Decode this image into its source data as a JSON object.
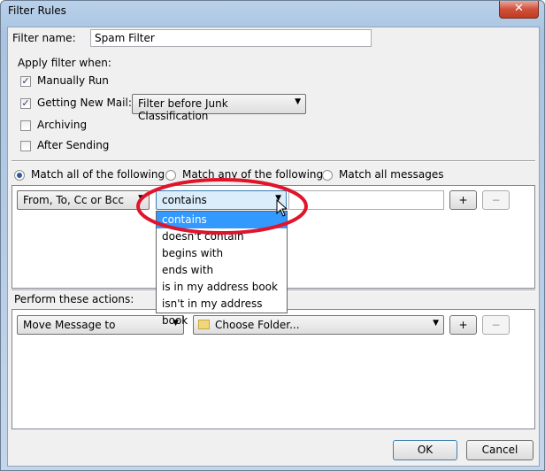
{
  "window": {
    "title": "Filter Rules",
    "close_glyph": "✕"
  },
  "filter_name": {
    "label": "Filter name:",
    "value": "Spam Filter"
  },
  "apply_when": {
    "legend": "Apply filter when:",
    "options": [
      {
        "label": "Manually Run",
        "checked": true,
        "mark": "✓"
      },
      {
        "label": "Getting New Mail:",
        "checked": true,
        "mark": "✓"
      },
      {
        "label": "Archiving",
        "checked": false,
        "mark": ""
      },
      {
        "label": "After Sending",
        "checked": false,
        "mark": ""
      }
    ],
    "new_mail_select": "Filter before Junk Classification"
  },
  "match": {
    "options": [
      {
        "label": "Match all of the following",
        "selected": true
      },
      {
        "label": "Match any of the following",
        "selected": false
      },
      {
        "label": "Match all messages",
        "selected": false
      }
    ]
  },
  "rule": {
    "field_select": "From, To, Cc or Bcc",
    "operator_select": "contains",
    "value": "",
    "add_label": "+",
    "remove_label": "−",
    "operator_options": [
      {
        "label": "contains",
        "selected": true
      },
      {
        "label": "doesn't contain",
        "selected": false
      },
      {
        "label": "begins with",
        "selected": false
      },
      {
        "label": "ends with",
        "selected": false
      },
      {
        "label": "is in my address book",
        "selected": false
      },
      {
        "label": "isn't in my address book",
        "selected": false
      }
    ]
  },
  "actions": {
    "label": "Perform these actions:",
    "action_select": "Move Message to",
    "folder_select": "Choose Folder...",
    "add_label": "+",
    "remove_label": "−"
  },
  "footer": {
    "ok_label": "OK",
    "cancel_label": "Cancel"
  },
  "annotation": {
    "color": "#e0142a"
  }
}
